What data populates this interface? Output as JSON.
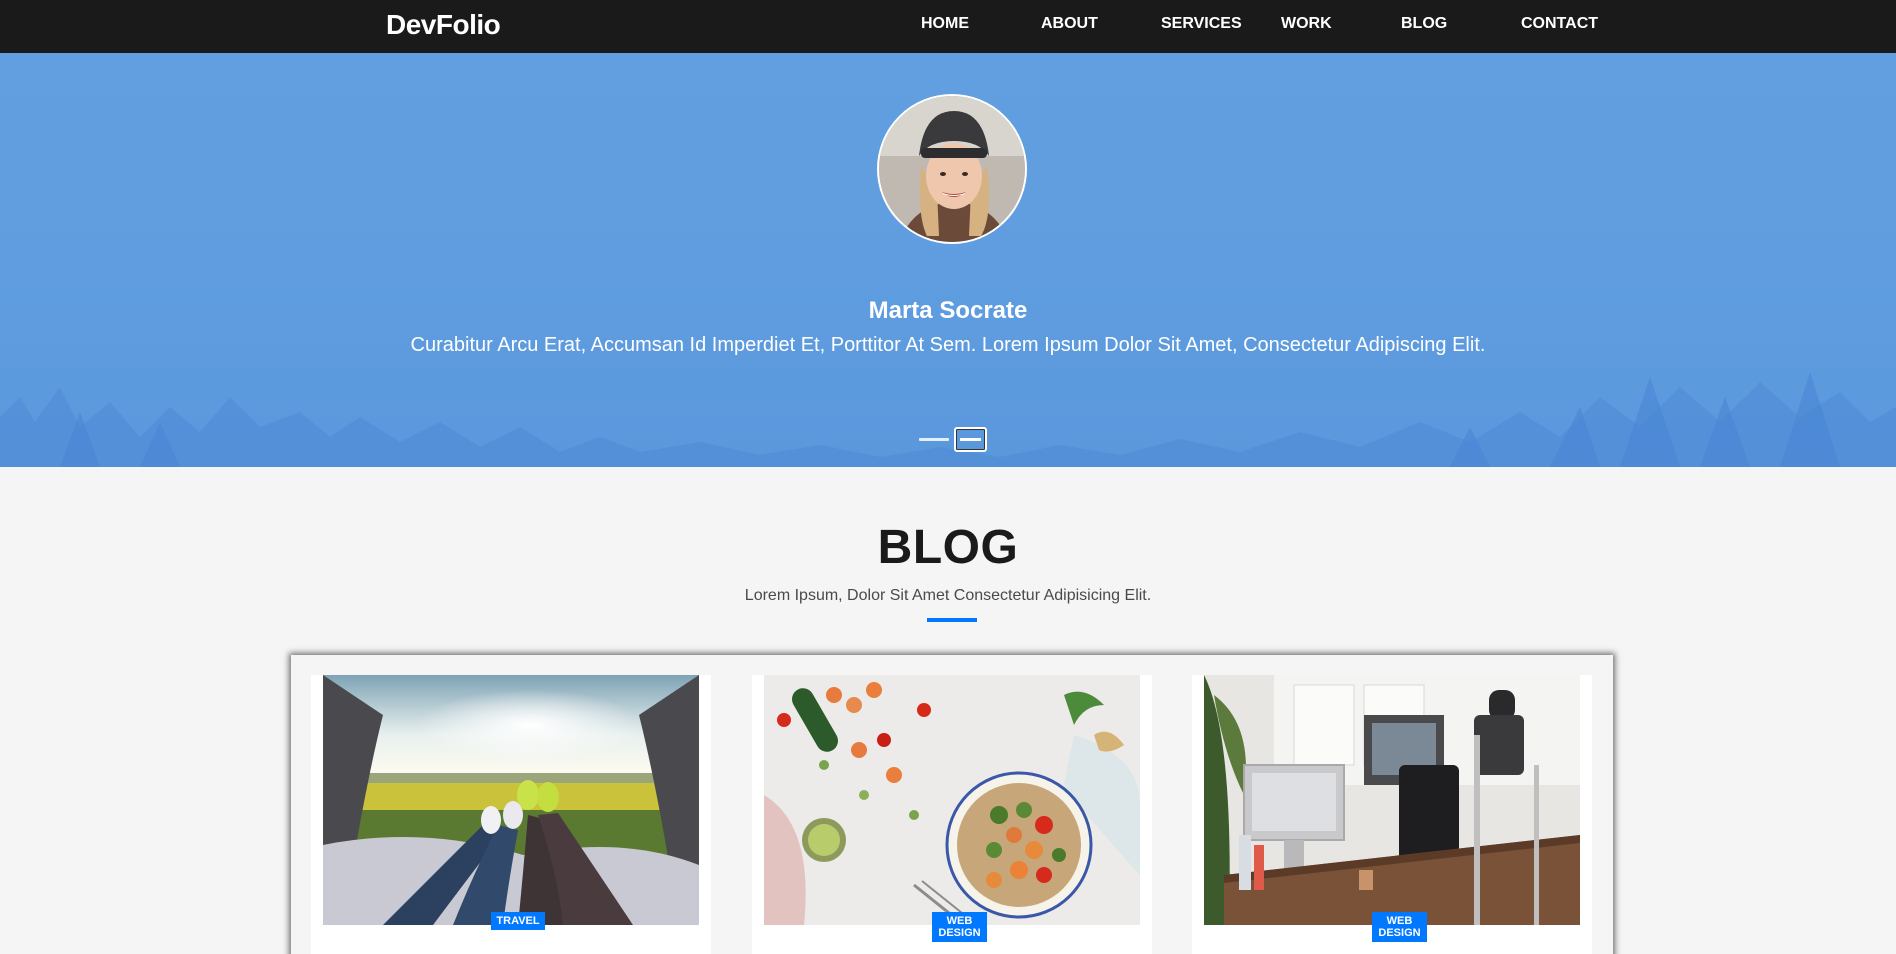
{
  "nav": {
    "brand": "DevFolio",
    "links": [
      "HOME",
      "ABOUT",
      "SERVICES",
      "WORK",
      "BLOG",
      "CONTACT"
    ]
  },
  "testimonial": {
    "name": "Marta Socrate",
    "text": "Curabitur Arcu Erat, Accumsan Id Imperdiet Et, Porttitor At Sem. Lorem Ipsum Dolor Sit Amet, Consectetur Adipiscing Elit.",
    "active_slide": 2,
    "slide_count": 2
  },
  "blog": {
    "title": "BLOG",
    "subtitle": "Lorem Ipsum, Dolor Sit Amet Consectetur Adipisicing Elit.",
    "cards": [
      {
        "tag": "TRAVEL",
        "image": "travel-photo"
      },
      {
        "tag": "WEB\nDESIGN",
        "image": "food-photo"
      },
      {
        "tag": "WEB\nDESIGN",
        "image": "office-photo"
      }
    ]
  },
  "colors": {
    "nav_bg": "#1a1a1a",
    "hero_bg": "#5f9de0",
    "accent": "#0078ff",
    "page_bg": "#f5f5f5"
  }
}
